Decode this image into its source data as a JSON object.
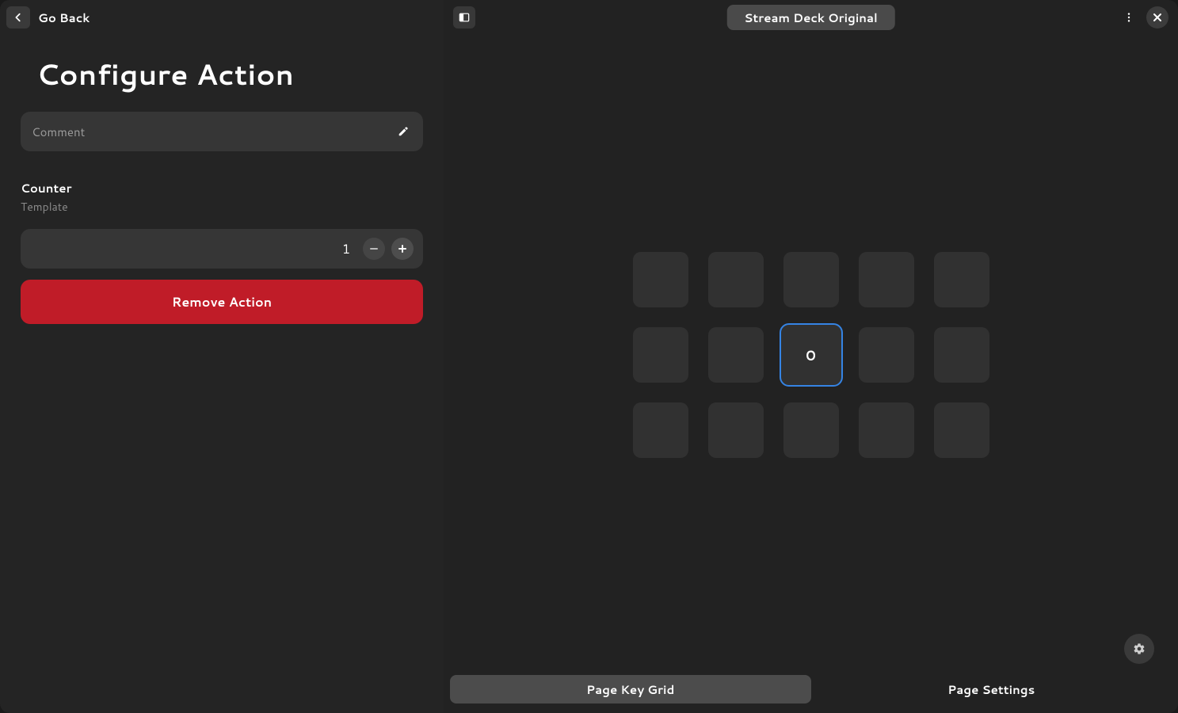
{
  "left": {
    "go_back": "Go Back",
    "title": "Configure Action",
    "comment_placeholder": "Comment",
    "counter_label": "Counter",
    "counter_sub": "Template",
    "counter_value": "1",
    "remove_label": "Remove Action"
  },
  "right": {
    "device_label": "Stream Deck Original",
    "selected_key_text": "0",
    "selected_index": 7,
    "grid_rows": 3,
    "grid_cols": 5,
    "tabs": {
      "key_grid": "Page Key Grid",
      "settings": "Page Settings",
      "active": "key_grid"
    }
  },
  "colors": {
    "accent": "#3584e4",
    "danger": "#c01c28"
  }
}
